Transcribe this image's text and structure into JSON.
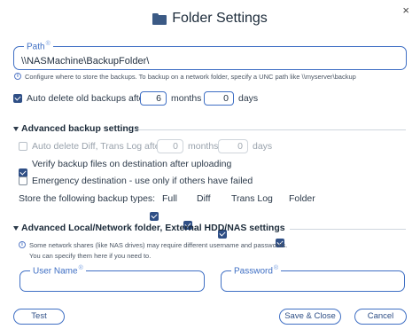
{
  "dialog": {
    "title": "Folder Settings",
    "close_glyph": "×",
    "title_icon": "folder-icon"
  },
  "path": {
    "label": "Path",
    "required_mark": "®",
    "value": "\\\\NASMachine\\BackupFolder\\",
    "hint": "Configure where to store the backups. To backup on a network folder, specify a UNC path like \\\\myserver\\backup"
  },
  "auto_delete": {
    "checked": true,
    "label": "Auto delete old backups after",
    "months": "6",
    "months_label": "months",
    "days": "0",
    "days_label": "days"
  },
  "advanced_backup": {
    "title": "Advanced backup settings",
    "auto_delete_diff": {
      "checked": false,
      "label": "Auto delete Diff, Trans Log after",
      "months": "0",
      "months_label": "months",
      "days": "0",
      "days_label": "days"
    },
    "verify": {
      "checked": true,
      "label": "Verify backup files on destination after uploading"
    },
    "emergency": {
      "checked": false,
      "label": "Emergency destination - use only if others have failed"
    },
    "types_label": "Store the following backup types:",
    "types": [
      {
        "label": "Full",
        "checked": true
      },
      {
        "label": "Diff",
        "checked": true
      },
      {
        "label": "Trans Log",
        "checked": true
      },
      {
        "label": "Folder",
        "checked": true
      }
    ]
  },
  "advanced_local": {
    "title": "Advanced Local/Network folder, External HDD/NAS settings",
    "note_line1": "Some network shares (like NAS drives) may require different username and passwords.",
    "note_line2": "You can specify them here if you need to.",
    "username_label": "User Name",
    "username_mark": "®",
    "password_label": "Password",
    "password_mark": "®"
  },
  "buttons": {
    "test": "Test",
    "save": "Save & Close",
    "cancel": "Cancel"
  }
}
